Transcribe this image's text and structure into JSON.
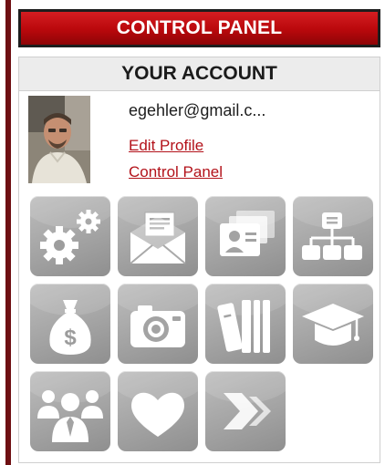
{
  "header": {
    "title": "CONTROL PANEL"
  },
  "account": {
    "section_title": "YOUR ACCOUNT",
    "email": "egehler@gmail.c...",
    "edit_profile_label": "Edit Profile",
    "control_panel_label": "Control Panel"
  },
  "icons": [
    "settings-gears-icon",
    "envelope-mail-icon",
    "id-cards-icon",
    "org-chart-icon",
    "money-bag-icon",
    "camera-icon",
    "books-icon",
    "graduation-cap-icon",
    "people-group-icon",
    "heart-icon",
    "forward-arrow-icon"
  ],
  "colors": {
    "header_red": "#b9080c",
    "link_red": "#b3121a",
    "tile_gray": "#a4a4a4",
    "accent_dark_red": "#6e0f12"
  }
}
